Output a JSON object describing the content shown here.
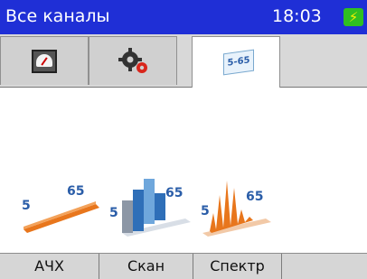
{
  "header": {
    "title": "Все каналы",
    "time": "18:03",
    "battery_icon": "charging-battery-icon"
  },
  "tabs": [
    {
      "name": "meter",
      "icon": "meter-gauge-icon"
    },
    {
      "name": "settings",
      "icon": "gear-settings-icon"
    },
    {
      "name": "range",
      "icon": "range-tag-icon",
      "label": "5-65"
    }
  ],
  "modes": [
    {
      "name": "frequency-response",
      "low": "5",
      "high": "65"
    },
    {
      "name": "scan",
      "low": "5",
      "high": "65"
    },
    {
      "name": "spectrum",
      "low": "5",
      "high": "65"
    }
  ],
  "softkeys": [
    {
      "label": "АЧХ"
    },
    {
      "label": "Скан"
    },
    {
      "label": "Спектр"
    },
    {
      "label": ""
    }
  ],
  "colors": {
    "header_bg": "#1f2fd6",
    "accent_orange": "#e8761c",
    "accent_blue": "#2a5da8",
    "battery": "#2fbf22"
  }
}
